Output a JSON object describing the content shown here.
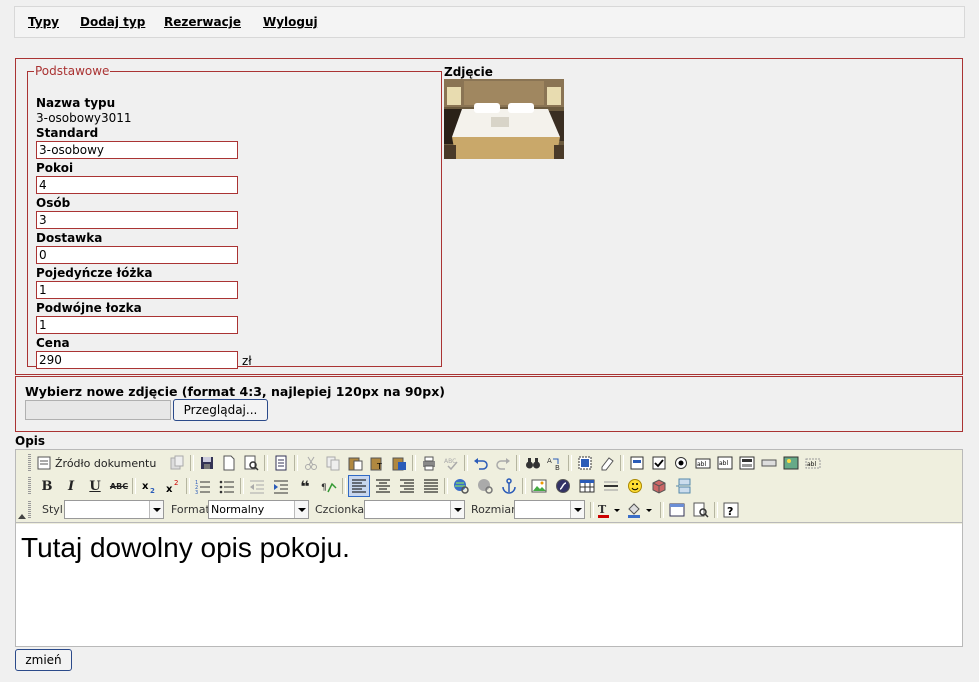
{
  "nav": {
    "items": [
      {
        "label": "Typy"
      },
      {
        "label": "Dodaj typ"
      },
      {
        "label": "Rezerwacje"
      },
      {
        "label": "Wyloguj"
      }
    ]
  },
  "basic": {
    "legend": "Podstawowe",
    "type_name_label": "Nazwa typu",
    "type_name_value": "3-osobowy3011",
    "standard_label": "Standard",
    "standard_value": "3-osobowy",
    "rooms_label": "Pokoi",
    "rooms_value": "4",
    "persons_label": "Osób",
    "persons_value": "3",
    "extra_bed_label": "Dostawka",
    "extra_bed_value": "0",
    "single_beds_label": "Pojedyńcze łóżka",
    "single_beds_value": "1",
    "double_beds_label": "Podwójne łozka",
    "double_beds_value": "1",
    "price_label": "Cena",
    "price_value": "290",
    "currency": "zł"
  },
  "photo": {
    "label": "Zdjęcie"
  },
  "upload": {
    "label": "Wybierz nowe zdjęcie (format 4:3, najlepiej 120px na 90px)",
    "browse_button": "Przeglądaj..."
  },
  "description": {
    "label": "Opis",
    "content": "Tutaj dowolny opis pokoju."
  },
  "editor": {
    "source_button": "Źródło dokumentu",
    "style_label": "Styl",
    "style_value": "",
    "format_label": "Format",
    "format_value": "Normalny",
    "font_label": "Czcionka",
    "font_value": "",
    "size_label": "Rozmiar",
    "size_value": ""
  },
  "submit_button": "zmień",
  "colors": {
    "accent": "#aa3333",
    "editor_toolbar": "#efefde",
    "active_button": "#c7d6ee"
  }
}
